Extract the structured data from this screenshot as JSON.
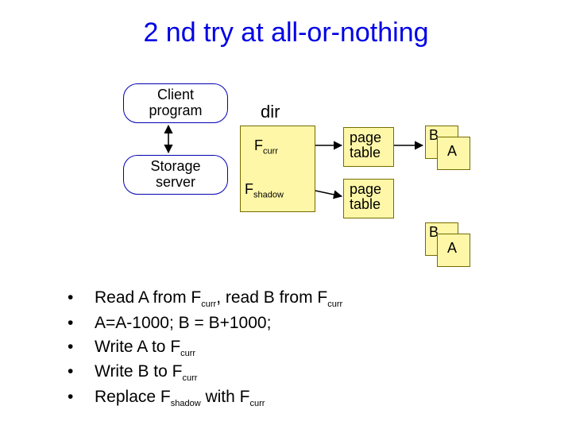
{
  "title": "2 nd try at all-or-nothing",
  "pills": {
    "client": "Client\nprogram",
    "storage": "Storage\nserver"
  },
  "dir_label": "dir",
  "dir_items": {
    "fcurr": "Fcurr",
    "fshadow": "Fshadow"
  },
  "pt1": "page\ntable",
  "pt2": "page\ntable",
  "stack1": {
    "back": "B",
    "front": "A"
  },
  "stack2": {
    "back": "B",
    "front": "A"
  },
  "bullets": [
    {
      "pre": "Read A from F",
      "sub1": "curr",
      "mid": ", read B from F",
      "sub2": "curr",
      "post": ""
    },
    {
      "pre": "A=A-1000; B = B+1000;",
      "sub1": "",
      "mid": "",
      "sub2": "",
      "post": ""
    },
    {
      "pre": "Write A to F",
      "sub1": "curr",
      "mid": "",
      "sub2": "",
      "post": ""
    },
    {
      "pre": "Write B to F",
      "sub1": "curr",
      "mid": "",
      "sub2": "",
      "post": ""
    },
    {
      "pre": "Replace F",
      "sub1": "shadow",
      "mid": " with F",
      "sub2": "curr",
      "post": ""
    }
  ]
}
